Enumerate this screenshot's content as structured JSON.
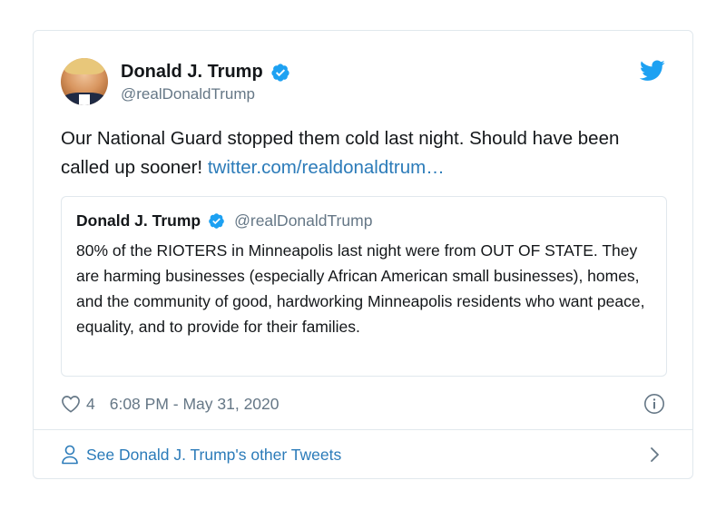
{
  "tweet": {
    "author": {
      "display_name": "Donald J. Trump",
      "handle": "@realDonaldTrump",
      "verified": true
    },
    "text": "Our National Guard stopped them cold last night. Should have been called up sooner! ",
    "link_text": "twitter.com/realdonaldtrum…",
    "quoted": {
      "display_name": "Donald J. Trump",
      "handle": "@realDonaldTrump",
      "text": "80% of the RIOTERS in Minneapolis last night were from OUT OF STATE. They are harming businesses (especially African American small businesses), homes, and the community of good, hardworking Minneapolis residents who want peace, equality, and to provide for their families."
    },
    "likes": "4",
    "timestamp": "6:08 PM - May 31, 2020"
  },
  "footer": {
    "label": "See Donald J. Trump's other Tweets"
  },
  "icons": {
    "brand": "twitter-bird-icon",
    "verified": "verified-badge-icon",
    "like": "heart-icon",
    "info": "info-icon",
    "profile": "person-icon",
    "chevron": "chevron-right-icon"
  },
  "colors": {
    "brand_blue": "#1da1f2",
    "link_blue": "#2b7bb9",
    "muted": "#657786",
    "text": "#14171a",
    "border": "#e1e8ed"
  }
}
